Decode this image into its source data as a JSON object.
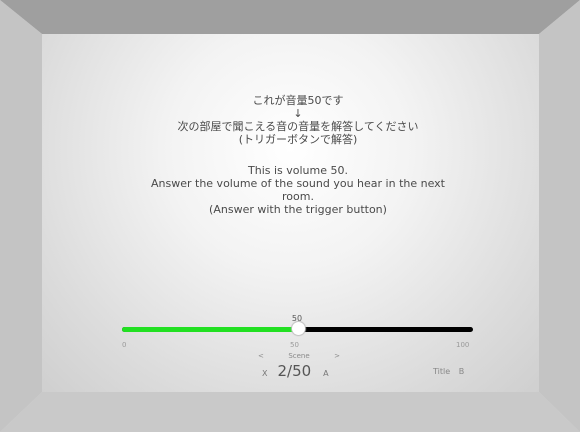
{
  "message_jp": {
    "line1": "これが音量50です",
    "arrow": "↓",
    "line2": "次の部屋で聞こえる音の音量を解答してください",
    "line3": "(トリガーボタンで解答)"
  },
  "message_en": {
    "line1": "This is volume 50.",
    "line2": "Answer the volume of the sound you hear in the next",
    "line3": "room.",
    "line4": "(Answer with the trigger button)"
  },
  "slider": {
    "value": 50,
    "min": 0,
    "max": 100,
    "value_label": "50",
    "min_label": "0",
    "mid_label": "50",
    "max_label": "100",
    "fill_color": "#22e022",
    "track_color": "#000000"
  },
  "scene_nav": {
    "prev": "<",
    "label": "Scene",
    "next": ">"
  },
  "controls": {
    "x_button": "X",
    "counter": "2/50",
    "a_button": "A",
    "title_label": "Title",
    "b_button": "B"
  }
}
